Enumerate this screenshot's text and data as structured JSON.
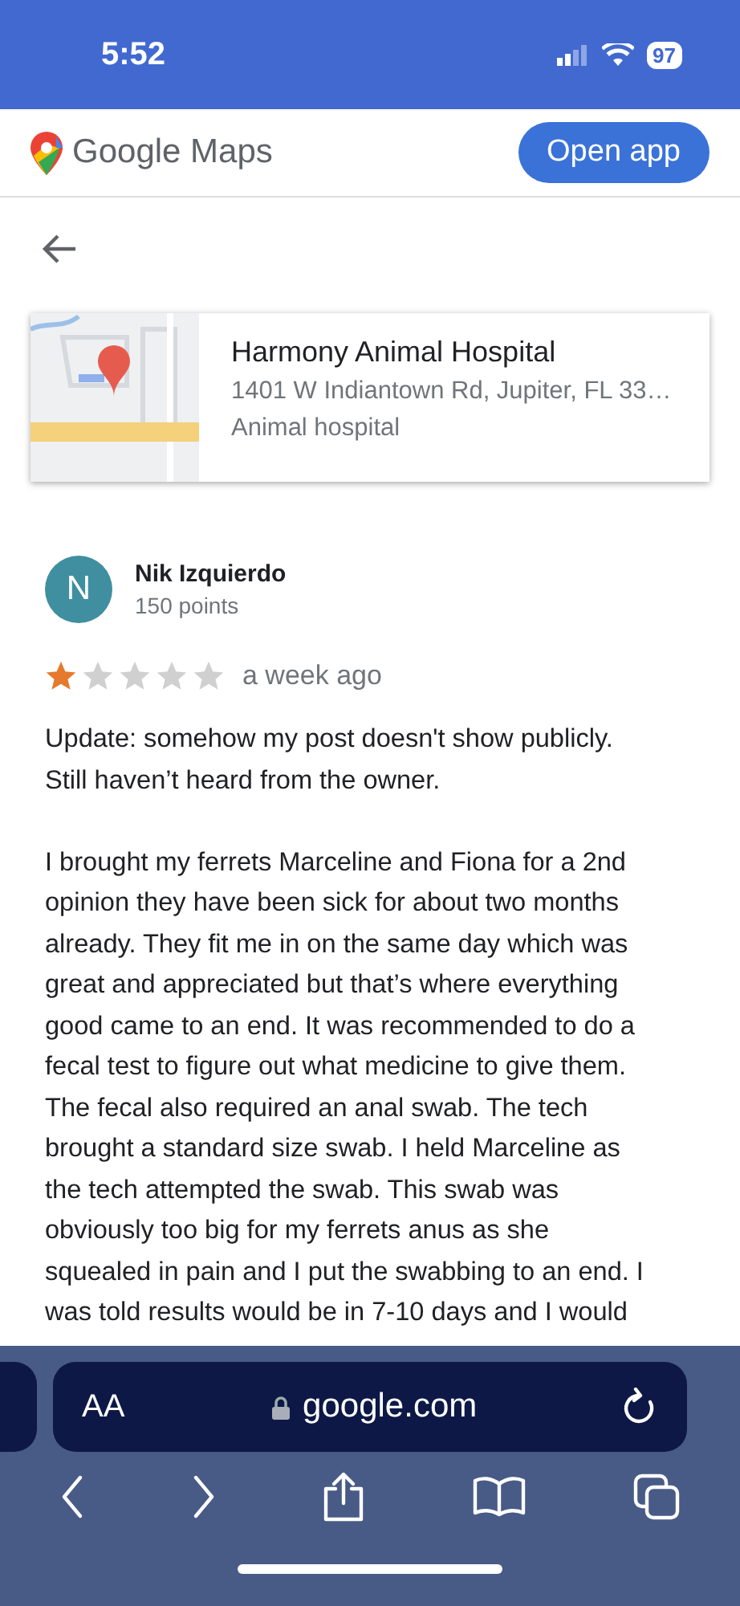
{
  "status_bar": {
    "time": "5:52",
    "battery": "97"
  },
  "header": {
    "logo_text": "Google Maps",
    "button": "Open app"
  },
  "place": {
    "name": "Harmony Animal Hospital",
    "address": "1401 W Indiantown Rd, Jupiter, FL 33…",
    "category": "Animal hospital"
  },
  "review": {
    "initial": "N",
    "author": "Nik Izquierdo",
    "points": "150 points",
    "stars": 1,
    "time": "a week ago",
    "paragraphs": [
      [
        "Update: somehow my post doesn't show publicly.",
        "Still haven’t heard from the owner."
      ],
      [
        "I brought my ferrets Marceline and Fiona for a 2nd",
        "opinion they have been sick for about two months",
        "already. They fit me in on the same day which was",
        "great and appreciated but that’s where everything",
        "good came to an end. It was recommended to do a",
        "fecal test to figure out what medicine to give them.",
        "The fecal also required an anal swab. The tech",
        "brought a standard size swab. I held Marceline as",
        "the tech attempted the swab. This swab was",
        "obviously too big for my ferrets anus as she",
        "squealed in pain and I put the swabbing to an end. I",
        "was told results would be in 7-10 days and I would"
      ]
    ]
  },
  "browser": {
    "text_size": "AA",
    "url": "google.com"
  }
}
